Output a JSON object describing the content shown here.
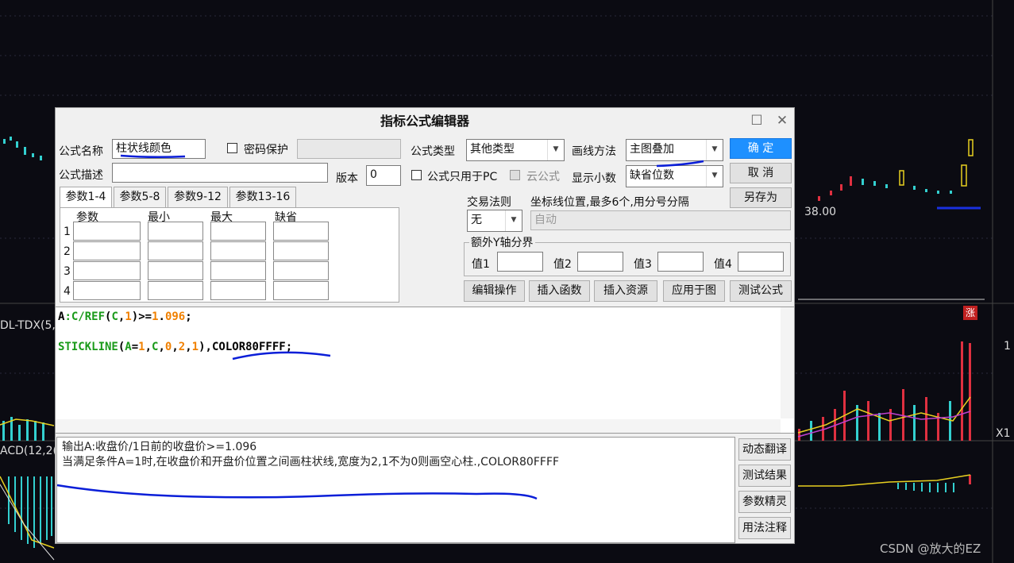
{
  "window": {
    "title": "指标公式编辑器"
  },
  "form": {
    "name_label": "公式名称",
    "name_value": "柱状线颜色",
    "password_label": "密码保护",
    "type_label": "公式类型",
    "type_value": "其他类型",
    "draw_label": "画线方法",
    "draw_value": "主图叠加",
    "desc_label": "公式描述",
    "version_label": "版本",
    "version_value": "0",
    "pc_only_label": "公式只用于PC",
    "cloud_label": "云公式",
    "decimals_label": "显示小数",
    "decimals_value": "缺省位数"
  },
  "buttons": {
    "ok": "确 定",
    "cancel": "取 消",
    "save_as": "另存为"
  },
  "tabs": [
    "参数1-4",
    "参数5-8",
    "参数9-12",
    "参数13-16"
  ],
  "params": {
    "headers": [
      "参数",
      "最小",
      "最大",
      "缺省"
    ],
    "rows": [
      "1",
      "2",
      "3",
      "4"
    ]
  },
  "trade": {
    "rule_label": "交易法则",
    "rule_value": "无",
    "coord_label": "坐标线位置,最多6个,用分号分隔",
    "coord_placeholder": "自动"
  },
  "yaxis": {
    "title": "额外Y轴分界",
    "labels": [
      "值1",
      "值2",
      "值3",
      "值4"
    ]
  },
  "actions": [
    "编辑操作",
    "插入函数",
    "插入资源",
    "应用于图",
    "测试公式"
  ],
  "code": {
    "line1": [
      "A",
      ":C/",
      "REF",
      "(",
      "C",
      ",",
      "1",
      ")>=",
      "1",
      ".",
      "096",
      ";"
    ],
    "line2": [
      "STICKLINE",
      "(",
      "A",
      "=",
      "1",
      ",",
      "C",
      ",",
      "0",
      ",",
      "2",
      ",",
      "1",
      ")",
      ",COLOR80FFFF;"
    ]
  },
  "output": {
    "line1": "输出A:收盘价/1日前的收盘价>=1.096",
    "line2": "当满足条件A=1时,在收盘价和开盘价位置之间画柱状线,宽度为2,1不为0则画空心柱.,COLOR80FFFF"
  },
  "side_buttons": [
    "动态翻译",
    "测试结果",
    "参数精灵",
    "用法注释"
  ],
  "background": {
    "price_label": "38.00",
    "indicator1": "DL-TDX(5,",
    "indicator2": "ACD(12,2(",
    "marker": "涨",
    "x1": "X1",
    "one": "1",
    "watermark": "CSDN @放大的EZ"
  },
  "colors": {
    "accent": "#1e90ff",
    "annotation": "#0a1ed8",
    "green_code": "#1a9a1a",
    "orange_code": "#f08000"
  }
}
